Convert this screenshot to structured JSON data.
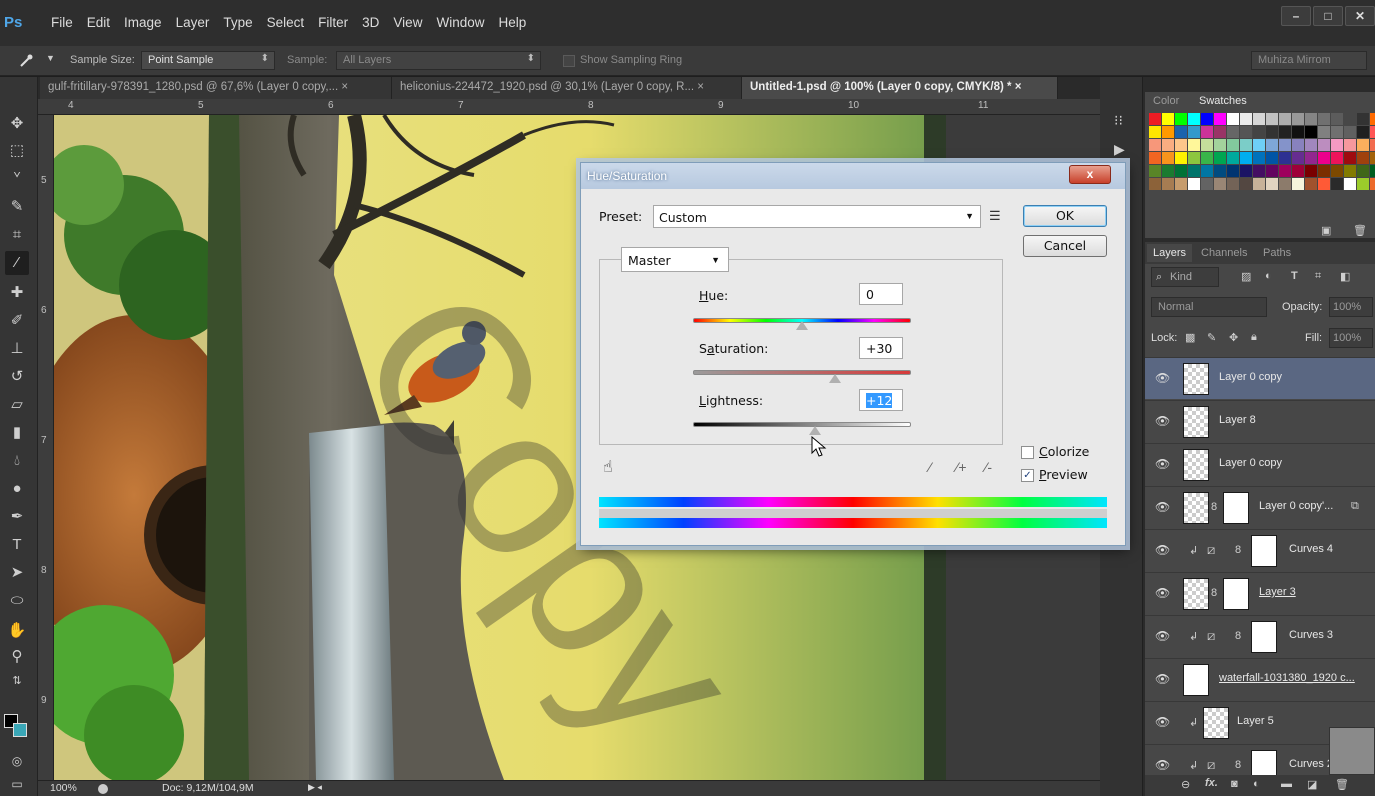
{
  "app": {
    "logo": "Ps"
  },
  "menu": [
    "File",
    "Edit",
    "Image",
    "Layer",
    "Type",
    "Select",
    "Filter",
    "3D",
    "View",
    "Window",
    "Help"
  ],
  "window_controls": {
    "minimize": "–",
    "maximize": "□",
    "close": "✕"
  },
  "options_bar": {
    "tool_icon": "eyedropper-icon",
    "sample_size_label": "Sample Size:",
    "sample_size_value": "Point Sample",
    "sample_label": "Sample:",
    "sample_value": "All Layers",
    "show_sampling_ring_label": "Show Sampling Ring",
    "workspace": "Muhiza Mirrom"
  },
  "doc_tabs": [
    {
      "label": "gulf-fritillary-978391_1280.psd @ 67,6% (Layer 0 copy,... ×",
      "active": false
    },
    {
      "label": "heliconius-224472_1920.psd @ 30,1% (Layer 0 copy, R... ×",
      "active": false
    },
    {
      "label": "Untitled-1.psd @ 100% (Layer 0 copy, CMYK/8) * ×",
      "active": true
    }
  ],
  "ruler": {
    "h": [
      "4",
      "5",
      "6",
      "7",
      "8",
      "9",
      "10",
      "11"
    ],
    "v": [
      "5",
      "6",
      "7",
      "8",
      "9"
    ]
  },
  "status": {
    "zoom": "100%",
    "doc": "Doc: 9,12M/104,9M"
  },
  "color_panel": {
    "tabs": [
      "Color",
      "Swatches"
    ],
    "active_tab": "Swatches",
    "swatches": [
      "#ed1c24",
      "#ffff00",
      "#00ff00",
      "#00ffff",
      "#0000ff",
      "#ff00ff",
      "#ffffff",
      "#ebebeb",
      "#d6d6d6",
      "#c2c2c2",
      "#adadad",
      "#999999",
      "#858585",
      "#707070",
      "#5c5c5c",
      "#474747",
      "#333333",
      "#ff6a00",
      "#ffe600",
      "#ff9900",
      "#1a63ad",
      "#3399cc",
      "#cc3399",
      "#993366",
      "#666666",
      "#555555",
      "#444444",
      "#333333",
      "#222222",
      "#111111",
      "#000000",
      "#808080",
      "#707070",
      "#606060",
      "#202020",
      "#ff5555",
      "#f7977a",
      "#f9ad81",
      "#fdc68a",
      "#fff79a",
      "#c4df9b",
      "#a3d39c",
      "#82ca9d",
      "#7bcdc8",
      "#6ecff6",
      "#7ea7d8",
      "#8493ca",
      "#8882be",
      "#a187be",
      "#bc8dbf",
      "#f49ac2",
      "#f6989d",
      "#fbaf5d",
      "#f26c4f",
      "#f26522",
      "#f7941d",
      "#fff200",
      "#8dc63f",
      "#39b54a",
      "#00a651",
      "#00a99d",
      "#00aeef",
      "#0072bc",
      "#0054a6",
      "#2e3192",
      "#662d91",
      "#92278f",
      "#ec008c",
      "#ed145b",
      "#9e0b0f",
      "#a0410d",
      "#a36209",
      "#598527",
      "#1a7b30",
      "#007236",
      "#00746b",
      "#0076a3",
      "#004b80",
      "#003471",
      "#1b1464",
      "#440e62",
      "#630460",
      "#9e005d",
      "#9e0039",
      "#790000",
      "#7b2e00",
      "#7d4900",
      "#827b00",
      "#406618",
      "#005e20",
      "#8c6239",
      "#a67c52",
      "#c69c6d",
      "#ffffff",
      "#636363",
      "#998675",
      "#736357",
      "#534741",
      "#c7b299",
      "#e1d4c0",
      "#8c7b6b",
      "#f5f5dc",
      "#a0522d",
      "#ff5a36",
      "#2a2a2a",
      "#ffffff",
      "#9ccc2b",
      "#ec6a2b"
    ]
  },
  "layers_panel": {
    "tabs": [
      "Layers",
      "Channels",
      "Paths"
    ],
    "active_tab": "Layers",
    "filter_label": "Kind",
    "blend_mode": "Normal",
    "opacity_label": "Opacity:",
    "opacity_value": "100%",
    "lock_label": "Lock:",
    "fill_label": "Fill:",
    "fill_value": "100%",
    "layers": [
      {
        "name": "Layer 0 copy",
        "selected": true,
        "type": "pixel",
        "underline": false
      },
      {
        "name": "Layer 8",
        "selected": false,
        "type": "pixel",
        "underline": false
      },
      {
        "name": "Layer 0 copy",
        "selected": false,
        "type": "pixel",
        "underline": false
      },
      {
        "name": "Layer 0 copy'...",
        "selected": false,
        "type": "masked",
        "underline": false
      },
      {
        "name": "Curves 4",
        "selected": false,
        "type": "curves",
        "underline": false
      },
      {
        "name": "Layer 3",
        "selected": false,
        "type": "masked",
        "underline": true
      },
      {
        "name": "Curves 3",
        "selected": false,
        "type": "curves",
        "underline": false
      },
      {
        "name": "waterfall-1031380_1920 c...",
        "selected": false,
        "type": "photo",
        "underline": true
      },
      {
        "name": "Layer 5",
        "selected": false,
        "type": "clipped",
        "underline": false
      },
      {
        "name": "Curves 2",
        "selected": false,
        "type": "curves",
        "underline": false
      }
    ],
    "footer_icons": [
      "link-icon",
      "fx-icon",
      "mask-icon",
      "adjustment-icon",
      "folder-icon",
      "new-layer-icon",
      "trash-icon"
    ]
  },
  "dialog": {
    "title": "Hue/Saturation",
    "close": "x",
    "preset_label": "Preset:",
    "preset_value": "Custom",
    "channel": "Master",
    "hue_label": "Hue:",
    "hue_value": "0",
    "hue_level": 0.5,
    "saturation_label": "Saturation:",
    "saturation_value": "+30",
    "saturation_level": 0.65,
    "lightness_label": "Lightness:",
    "lightness_value": "+12",
    "lightness_level": 0.56,
    "ok_label": "OK",
    "cancel_label": "Cancel",
    "colorize_label": "Colorize",
    "colorize_checked": false,
    "preview_label": "Preview",
    "preview_checked": true
  },
  "watermark": "Copy"
}
